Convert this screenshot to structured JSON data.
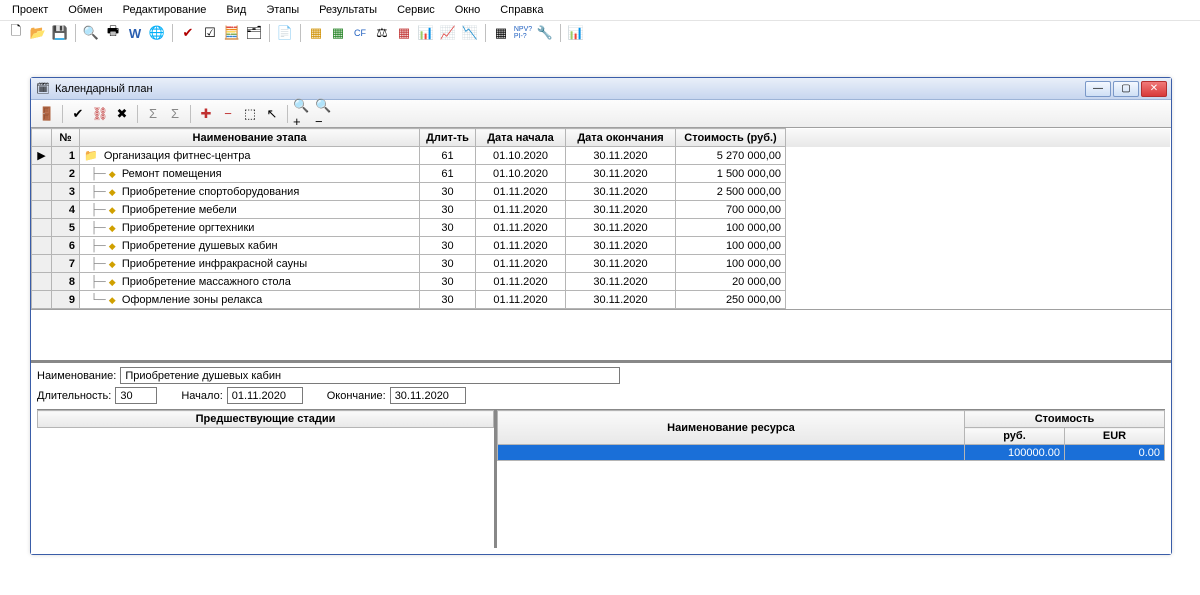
{
  "menubar": [
    "Проект",
    "Обмен",
    "Редактирование",
    "Вид",
    "Этапы",
    "Результаты",
    "Сервис",
    "Окно",
    "Справка"
  ],
  "window": {
    "title": "Календарный план"
  },
  "grid": {
    "headers": {
      "no": "№",
      "name": "Наименование этапа",
      "duration": "Длит-ть",
      "start": "Дата начала",
      "end": "Дата окончания",
      "cost": "Стоимость (руб.)"
    },
    "rows": [
      {
        "no": "1",
        "marker": "▶",
        "icon": "folder",
        "name": "Организация фитнес-центра",
        "dur": "61",
        "start": "01.10.2020",
        "end": "30.11.2020",
        "cost": "5 270 000,00"
      },
      {
        "no": "2",
        "marker": "",
        "icon": "node",
        "name": "Ремонт помещения",
        "dur": "61",
        "start": "01.10.2020",
        "end": "30.11.2020",
        "cost": "1 500 000,00"
      },
      {
        "no": "3",
        "marker": "",
        "icon": "node",
        "name": "Приобретение спортоборудования",
        "dur": "30",
        "start": "01.11.2020",
        "end": "30.11.2020",
        "cost": "2 500 000,00"
      },
      {
        "no": "4",
        "marker": "",
        "icon": "node",
        "name": "Приобретение мебели",
        "dur": "30",
        "start": "01.11.2020",
        "end": "30.11.2020",
        "cost": "700 000,00"
      },
      {
        "no": "5",
        "marker": "",
        "icon": "node",
        "name": "Приобретение оргтехники",
        "dur": "30",
        "start": "01.11.2020",
        "end": "30.11.2020",
        "cost": "100 000,00"
      },
      {
        "no": "6",
        "marker": "",
        "icon": "node",
        "name": "Приобретение душевых кабин",
        "dur": "30",
        "start": "01.11.2020",
        "end": "30.11.2020",
        "cost": "100 000,00"
      },
      {
        "no": "7",
        "marker": "",
        "icon": "node",
        "name": "Приобретение инфракрасной сауны",
        "dur": "30",
        "start": "01.11.2020",
        "end": "30.11.2020",
        "cost": "100 000,00"
      },
      {
        "no": "8",
        "marker": "",
        "icon": "node",
        "name": "Приобретение массажного стола",
        "dur": "30",
        "start": "01.11.2020",
        "end": "30.11.2020",
        "cost": "20 000,00"
      },
      {
        "no": "9",
        "marker": "",
        "icon": "node-last",
        "name": "Оформление зоны релакса",
        "dur": "30",
        "start": "01.11.2020",
        "end": "30.11.2020",
        "cost": "250 000,00"
      }
    ]
  },
  "details": {
    "name_label": "Наименование:",
    "name_value": "Приобретение душевых кабин",
    "dur_label": "Длительность:",
    "dur_value": "30",
    "start_label": "Начало:",
    "start_value": "01.11.2020",
    "end_label": "Окончание:",
    "end_value": "30.11.2020",
    "prev_stages_header": "Предшествующие стадии",
    "resource_header": "Наименование ресурса",
    "cost_header": "Стоимость",
    "cost_rub": "руб.",
    "cost_eur": "EUR",
    "cost_row": {
      "rub": "100000.00",
      "eur": "0.00"
    }
  }
}
